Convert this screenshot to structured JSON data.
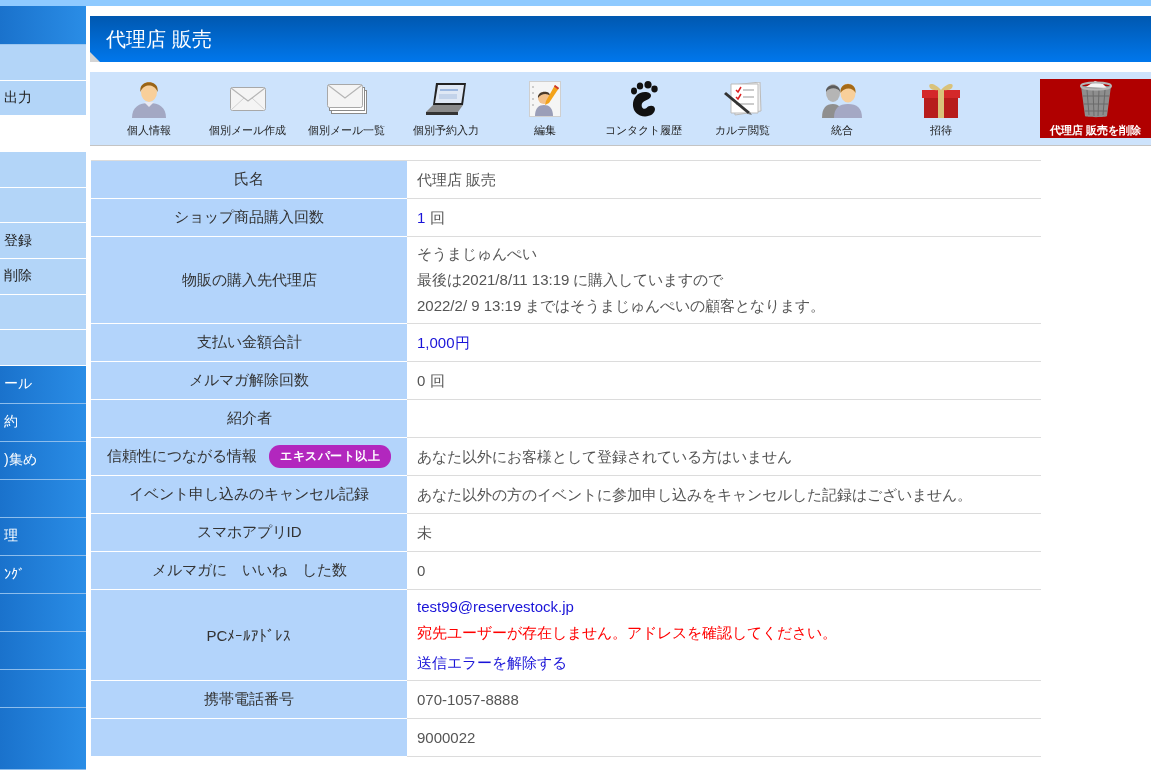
{
  "sidebar": {
    "items": [
      {
        "kind": "header"
      },
      {
        "kind": "light"
      },
      {
        "kind": "light",
        "label": "出力"
      },
      {
        "kind": "gap"
      },
      {
        "kind": "light"
      },
      {
        "kind": "light"
      },
      {
        "kind": "light",
        "label": "登録"
      },
      {
        "kind": "light",
        "label": "削除"
      },
      {
        "kind": "light"
      },
      {
        "kind": "light"
      },
      {
        "kind": "dark",
        "label": "ール"
      },
      {
        "kind": "dark",
        "label": "約"
      },
      {
        "kind": "dark",
        "label": ")集め"
      },
      {
        "kind": "dark"
      },
      {
        "kind": "dark",
        "label": "理"
      },
      {
        "kind": "dark",
        "label": "ﾝｸﾞ"
      },
      {
        "kind": "dark"
      },
      {
        "kind": "dark"
      },
      {
        "kind": "dark"
      },
      {
        "kind": "dark"
      }
    ]
  },
  "page_title": "代理店 販売",
  "toolbar": {
    "items": [
      {
        "label": "個人情報",
        "kind": "normal"
      },
      {
        "label": "個別メール作成",
        "kind": "normal"
      },
      {
        "label": "個別メール一覧",
        "kind": "normal"
      },
      {
        "label": "個別予約入力",
        "kind": "normal"
      },
      {
        "label": "編集",
        "kind": "normal"
      },
      {
        "label": "コンタクト履歴",
        "kind": "normal"
      },
      {
        "label": "カルテ閲覧",
        "kind": "normal"
      },
      {
        "label": "統合",
        "kind": "normal"
      },
      {
        "label": "招待",
        "kind": "normal"
      },
      {
        "label": "代理店 販売を削除",
        "kind": "danger"
      }
    ]
  },
  "profile_table": {
    "rows": [
      {
        "label": "氏名",
        "lines": [
          {
            "kind": "plain",
            "text": "代理店 販売"
          }
        ]
      },
      {
        "label": "ショップ商品購入回数",
        "lines": [
          {
            "kind": "link",
            "text": "1",
            "suffix": "回"
          }
        ]
      },
      {
        "label": "物販の購入先代理店",
        "lines": [
          {
            "kind": "plain",
            "text": "そうまじゅんぺい"
          },
          {
            "kind": "plain",
            "text": "最後は2021/8/11 13:19 に購入していますので"
          },
          {
            "kind": "plain",
            "text": "2022/2/ 9 13:19 まではそうまじゅんぺいの顧客となります。"
          }
        ]
      },
      {
        "label": "支払い金額合計",
        "lines": [
          {
            "kind": "link",
            "text": "1,000円"
          }
        ]
      },
      {
        "label": "メルマガ解除回数",
        "lines": [
          {
            "kind": "plain",
            "text": "0 回"
          }
        ]
      },
      {
        "label": "紹介者"
      },
      {
        "label": "信頼性につながる情報",
        "badge": "エキスパート以上",
        "lines": [
          {
            "kind": "plain",
            "text": "あなた以外にお客様として登録されている方はいません"
          }
        ]
      },
      {
        "label": "イベント申し込みのキャンセル記録",
        "lines": [
          {
            "kind": "plain",
            "text": "あなた以外の方のイベントに参加申し込みをキャンセルした記録はございません。"
          }
        ]
      },
      {
        "label": "スマホアプリID",
        "lines": [
          {
            "kind": "plain",
            "text": "未"
          }
        ]
      },
      {
        "label": "メルマガに　いいね　した数",
        "lines": [
          {
            "kind": "plain",
            "text": "0"
          }
        ]
      },
      {
        "label": "PCﾒｰﾙｱﾄﾞﾚｽ",
        "lines": [
          {
            "kind": "link",
            "text": "test99@reservestock.jp"
          },
          {
            "kind": "error",
            "text": "宛先ユーザーが存在しません。アドレスを確認してください。"
          },
          {
            "kind": "action",
            "text": "送信エラーを解除する"
          }
        ]
      },
      {
        "label": "携帯電話番号",
        "lines": [
          {
            "kind": "plain",
            "text": "070-1057-8888"
          }
        ]
      },
      {
        "lines": [
          {
            "kind": "plain",
            "text": "9000022"
          }
        ]
      }
    ]
  }
}
